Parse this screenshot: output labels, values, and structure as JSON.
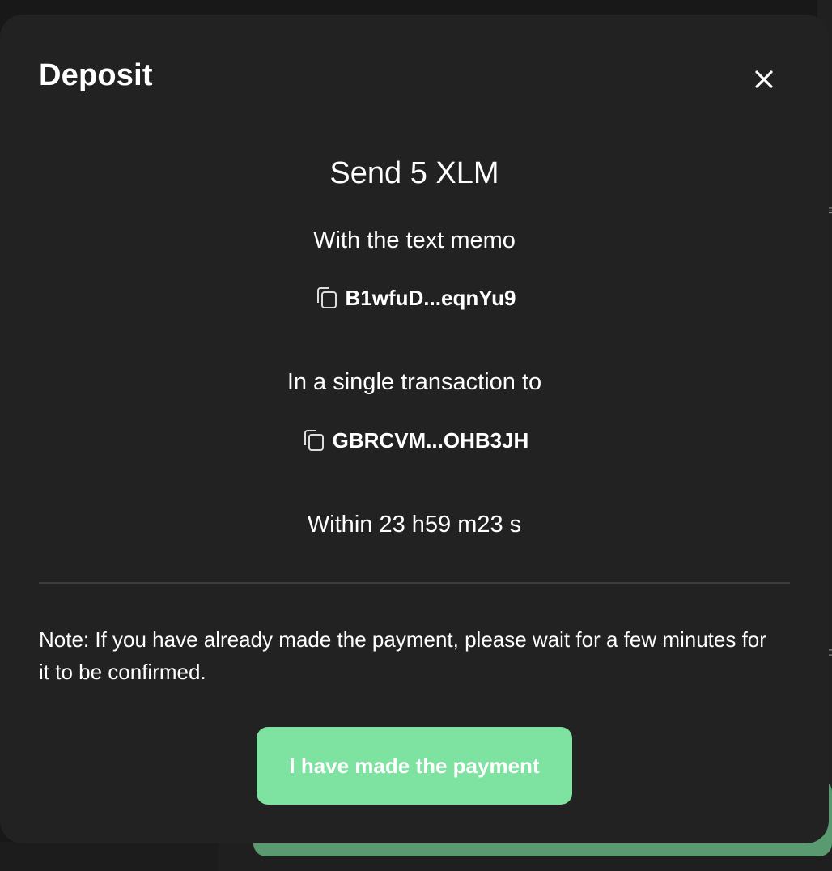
{
  "modal": {
    "title": "Deposit",
    "close_icon": "close-icon",
    "send_heading": "Send 5 XLM",
    "memo_label": "With the text memo",
    "memo_value": "B1wfuD...eqnYu9",
    "tx_label": "In a single transaction to",
    "address_value": "GBRCVM...OHB3JH",
    "copy_icon": "copy-icon",
    "deadline": "Within 23 h59 m23 s",
    "note": "Note: If you have already made the payment, please wait for a few minutes for it to be confirmed.",
    "confirm_button_label": "I have made the payment"
  },
  "colors": {
    "modal_bg": "#222222",
    "page_bg": "#181818",
    "accent": "#7ee2a0",
    "divider": "#3c3c3c",
    "text": "#ffffff"
  }
}
